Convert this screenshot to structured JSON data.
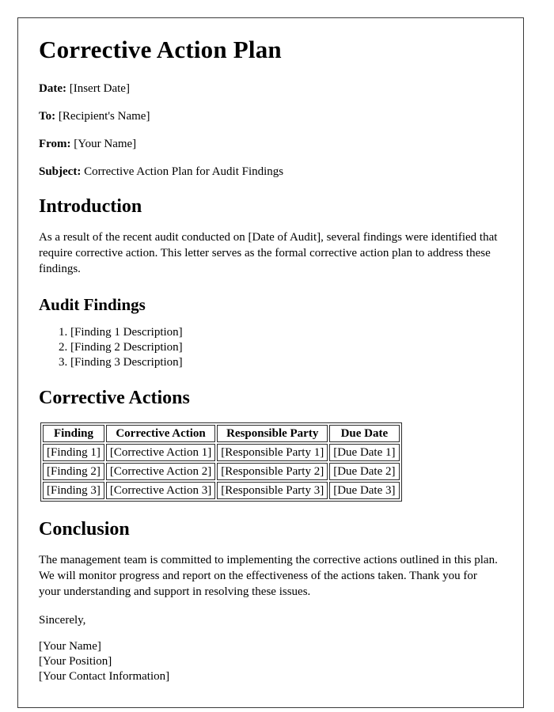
{
  "document": {
    "title": "Corrective Action Plan",
    "meta": [
      {
        "label": "Date:",
        "value": "[Insert Date]"
      },
      {
        "label": "To:",
        "value": "[Recipient's Name]"
      },
      {
        "label": "From:",
        "value": "[Your Name]"
      },
      {
        "label": "Subject:",
        "value": "Corrective Action Plan for Audit Findings"
      }
    ],
    "introduction": {
      "heading": "Introduction",
      "paragraph": "As a result of the recent audit conducted on [Date of Audit], several findings were identified that require corrective action. This letter serves as the formal corrective action plan to address these findings."
    },
    "audit_findings": {
      "heading": "Audit Findings",
      "items": [
        "[Finding 1 Description]",
        "[Finding 2 Description]",
        "[Finding 3 Description]"
      ]
    },
    "corrective_actions": {
      "heading": "Corrective Actions",
      "table": {
        "columns": [
          "Finding",
          "Corrective Action",
          "Responsible Party",
          "Due Date"
        ],
        "rows": [
          [
            "[Finding 1]",
            "[Corrective Action 1]",
            "[Responsible Party 1]",
            "[Due Date 1]"
          ],
          [
            "[Finding 2]",
            "[Corrective Action 2]",
            "[Responsible Party 2]",
            "[Due Date 2]"
          ],
          [
            "[Finding 3]",
            "[Corrective Action 3]",
            "[Responsible Party 3]",
            "[Due Date 3]"
          ]
        ]
      }
    },
    "conclusion": {
      "heading": "Conclusion",
      "paragraph": "The management team is committed to implementing the corrective actions outlined in this plan. We will monitor progress and report on the effectiveness of the actions taken. Thank you for your understanding and support in resolving these issues.",
      "sign_off": "Sincerely,",
      "signature": [
        "[Your Name]",
        "[Your Position]",
        "[Your Contact Information]"
      ]
    }
  },
  "colors": {
    "text": "#000000",
    "page_border": "#3a3a3a",
    "table_border": "#2b2b2b",
    "background": "#ffffff"
  }
}
